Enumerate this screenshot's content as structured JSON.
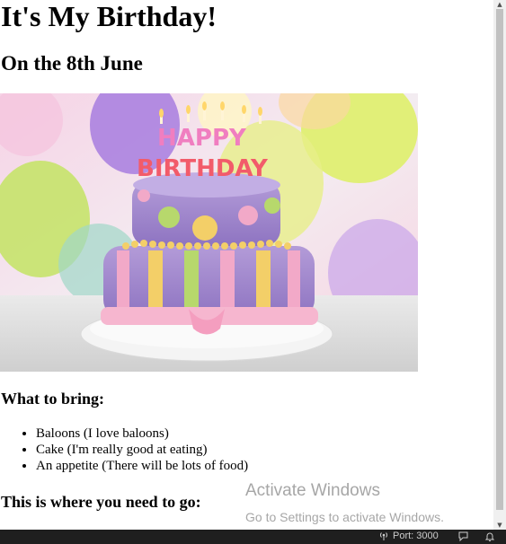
{
  "page": {
    "title": "It's My Birthday!",
    "subtitle": "On the 8th June",
    "bring_heading": "What to bring:",
    "bring_items": [
      "Baloons (I love baloons)",
      "Cake (I'm really good at eating)",
      "An appetite (There will be lots of food)"
    ],
    "go_heading": "This is where you need to go:"
  },
  "cake_image": {
    "top_text": "HAPPY",
    "bottom_text": "BIRTHDAY"
  },
  "watermark": {
    "title": "Activate Windows",
    "subtitle": "Go to Settings to activate Windows."
  },
  "statusbar": {
    "port_label": "Port: 3000",
    "port_icon": "broadcast-icon",
    "feedback_icon": "feedback-icon",
    "bell_icon": "bell-icon"
  },
  "colors": {
    "statusbar_bg": "#1f1f1f",
    "scrollbar_thumb": "#c1c1c1"
  }
}
